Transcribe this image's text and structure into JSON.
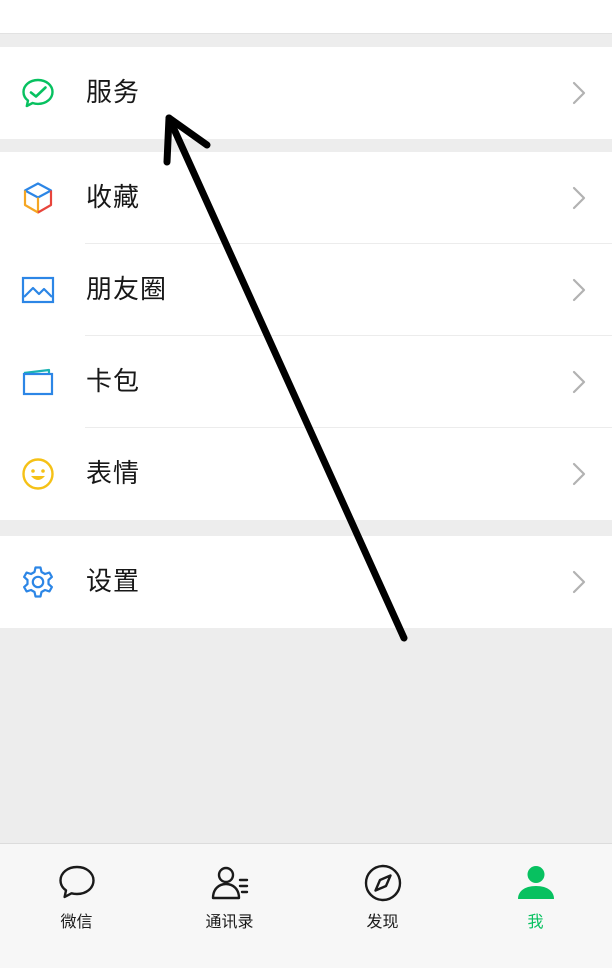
{
  "menu": {
    "service": {
      "label": "服务",
      "icon": "service-icon"
    },
    "favorites": {
      "label": "收藏",
      "icon": "cube-icon"
    },
    "moments": {
      "label": "朋友圈",
      "icon": "image-icon"
    },
    "cards": {
      "label": "卡包",
      "icon": "card-icon"
    },
    "stickers": {
      "label": "表情",
      "icon": "smile-icon"
    },
    "settings": {
      "label": "设置",
      "icon": "gear-icon"
    }
  },
  "tabbar": {
    "chats": {
      "label": "微信",
      "icon": "chat-bubble-icon"
    },
    "contacts": {
      "label": "通讯录",
      "icon": "contacts-icon"
    },
    "discover": {
      "label": "发现",
      "icon": "compass-icon"
    },
    "me": {
      "label": "我",
      "icon": "person-icon"
    }
  },
  "colors": {
    "accent_green": "#07c160",
    "background": "#ededed",
    "row_background": "#ffffff",
    "chevron": "#b2b2b2",
    "icon_blue": "#2c86e6",
    "icon_yellow": "#f5c116"
  }
}
